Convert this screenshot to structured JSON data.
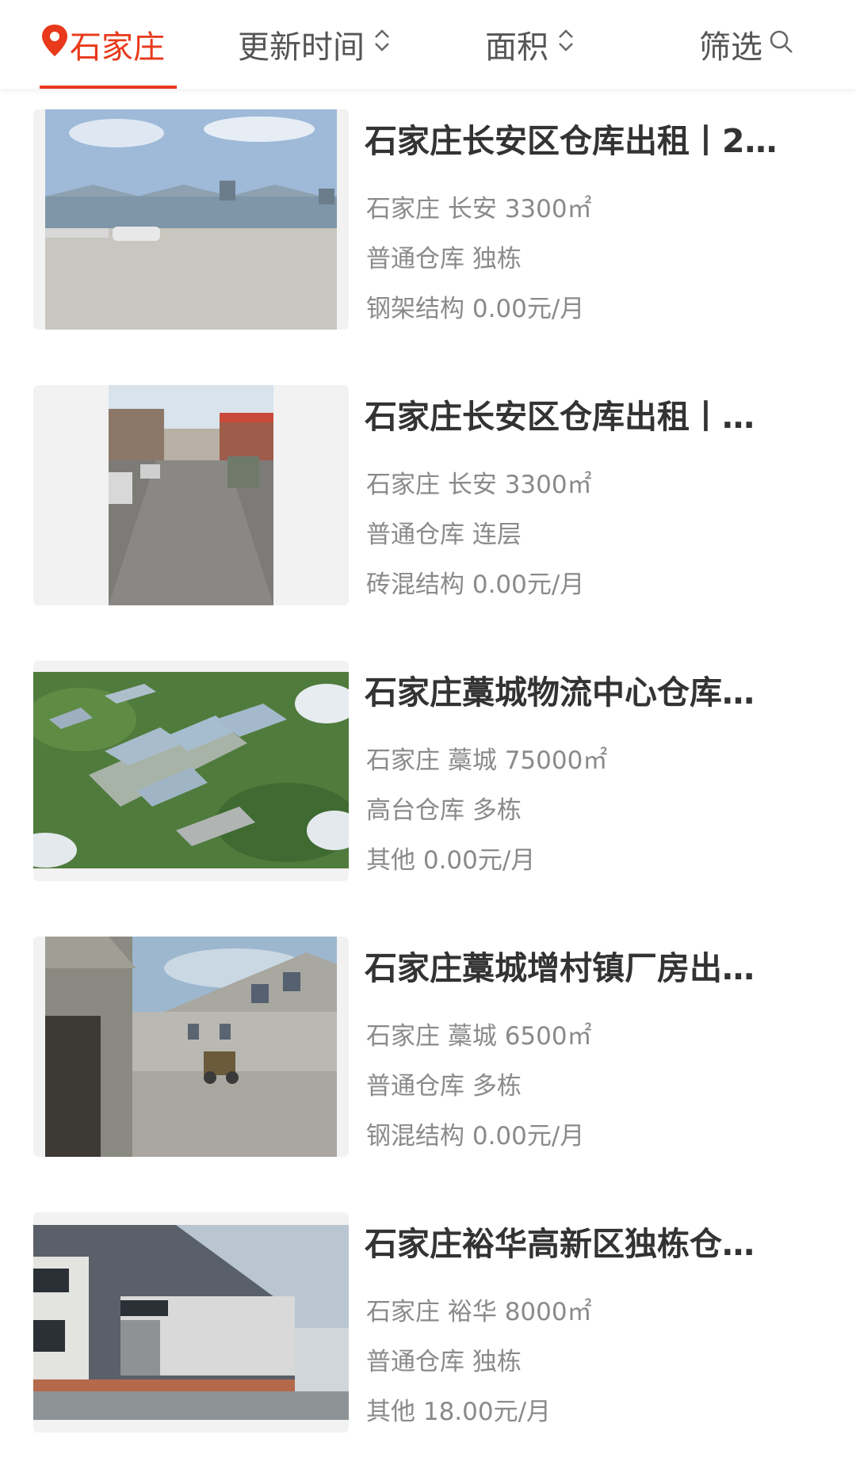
{
  "topbar": {
    "city_label": "石家庄",
    "updated_label": "更新时间",
    "area_label": "面积",
    "filter_label": "筛选",
    "accent_color": "#e8391a",
    "icons": {
      "location": "location-pin-icon",
      "sort": "sort-updown-icon",
      "search": "search-icon"
    }
  },
  "listings": [
    {
      "title": "石家庄长安区仓库出租丨2…",
      "location": "石家庄 长安 3300㎡",
      "type": "普通仓库 独栋",
      "structure_price": "钢架结构 0.00元/月"
    },
    {
      "title": "石家庄长安区仓库出租丨…",
      "location": "石家庄 长安 3300㎡",
      "type": "普通仓库 连层",
      "structure_price": "砖混结构 0.00元/月"
    },
    {
      "title": "石家庄藁城物流中心仓库…",
      "location": "石家庄 藁城 75000㎡",
      "type": "高台仓库 多栋",
      "structure_price": "其他 0.00元/月"
    },
    {
      "title": "石家庄藁城增村镇厂房出…",
      "location": "石家庄 藁城 6500㎡",
      "type": "普通仓库 多栋",
      "structure_price": "钢混结构 0.00元/月"
    },
    {
      "title": "石家庄裕华高新区独栋仓…",
      "location": "石家庄 裕华 8000㎡",
      "type": "普通仓库 独栋",
      "structure_price": "其他 18.00元/月"
    }
  ]
}
